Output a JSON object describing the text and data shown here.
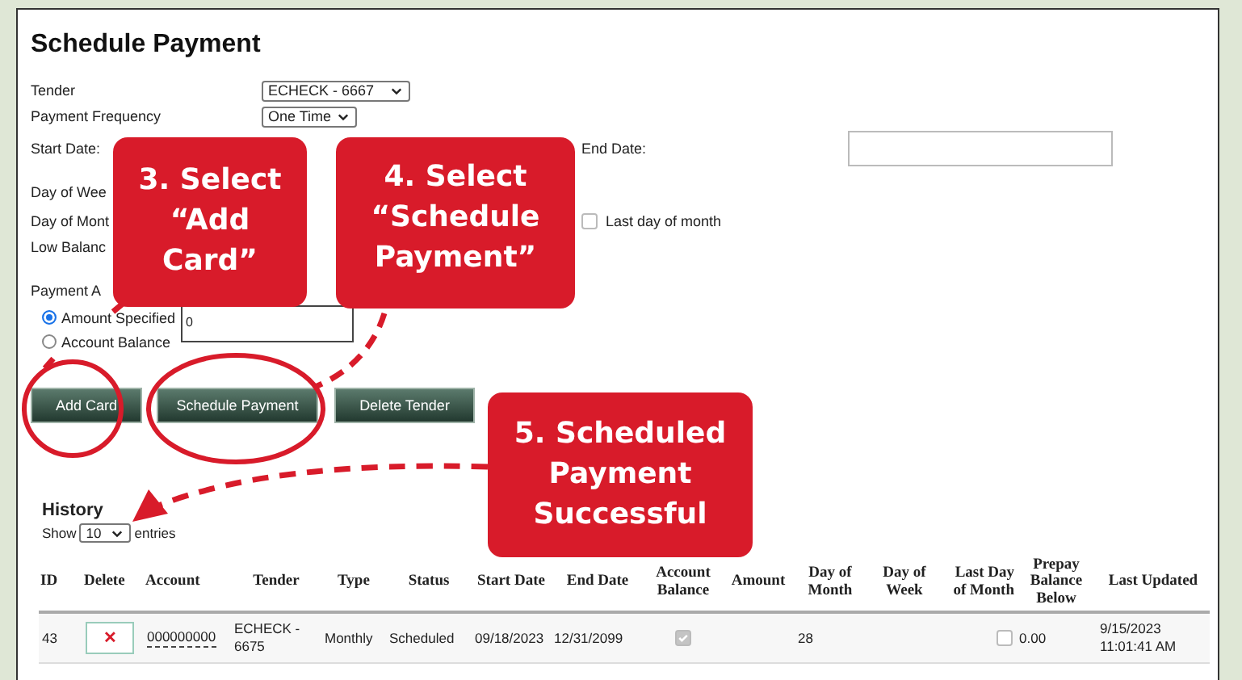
{
  "title": "Schedule Payment",
  "tender": {
    "label": "Tender",
    "value": "ECHECK - 6667"
  },
  "frequency": {
    "label": "Payment Frequency",
    "value": "One Time"
  },
  "start_date": {
    "label": "Start Date:"
  },
  "end_date": {
    "label": "End Date:"
  },
  "day_of_week": {
    "label": "Day of Wee"
  },
  "day_of_month": {
    "label": "Day of Mont"
  },
  "last_day": {
    "label": "Last day of month",
    "checked": false
  },
  "low_balance": {
    "label": "Low Balanc"
  },
  "payment_amount": {
    "label": "Payment A"
  },
  "amount_options": [
    {
      "label": "Amount Specified",
      "selected": true
    },
    {
      "label": "Account Balance",
      "selected": false
    }
  ],
  "amount_value": "0",
  "buttons": [
    "Add Card",
    "Schedule Payment",
    "Delete Tender"
  ],
  "history": {
    "title": "History",
    "show": "Show",
    "page_size": "10",
    "entries": "entries",
    "columns": [
      "ID",
      "Delete",
      "Account",
      "Tender",
      "Type",
      "Status",
      "Start Date",
      "End Date",
      "Account Balance",
      "Amount",
      "Day of Month",
      "Day of Week",
      "Last Day of Month",
      "Prepay Balance Below",
      "Last Updated"
    ],
    "rows": [
      {
        "id": "43",
        "delete": "✕",
        "account": "000000000",
        "tender": "ECHECK - 6675",
        "type": "Monthly",
        "status": "Scheduled",
        "start": "09/18/2023",
        "end": "12/31/2099",
        "account_balance": true,
        "day_of_month": "28",
        "last_day_of_month": false,
        "prepay": "0.00",
        "updated": "9/15/2023 11:01:41 AM"
      }
    ]
  },
  "callouts": [
    {
      "text": "3. Select\n“Add\nCard”"
    },
    {
      "text": "4. Select\n“Schedule\nPayment”"
    },
    {
      "text": "5. Scheduled\nPayment\nSuccessful"
    }
  ]
}
